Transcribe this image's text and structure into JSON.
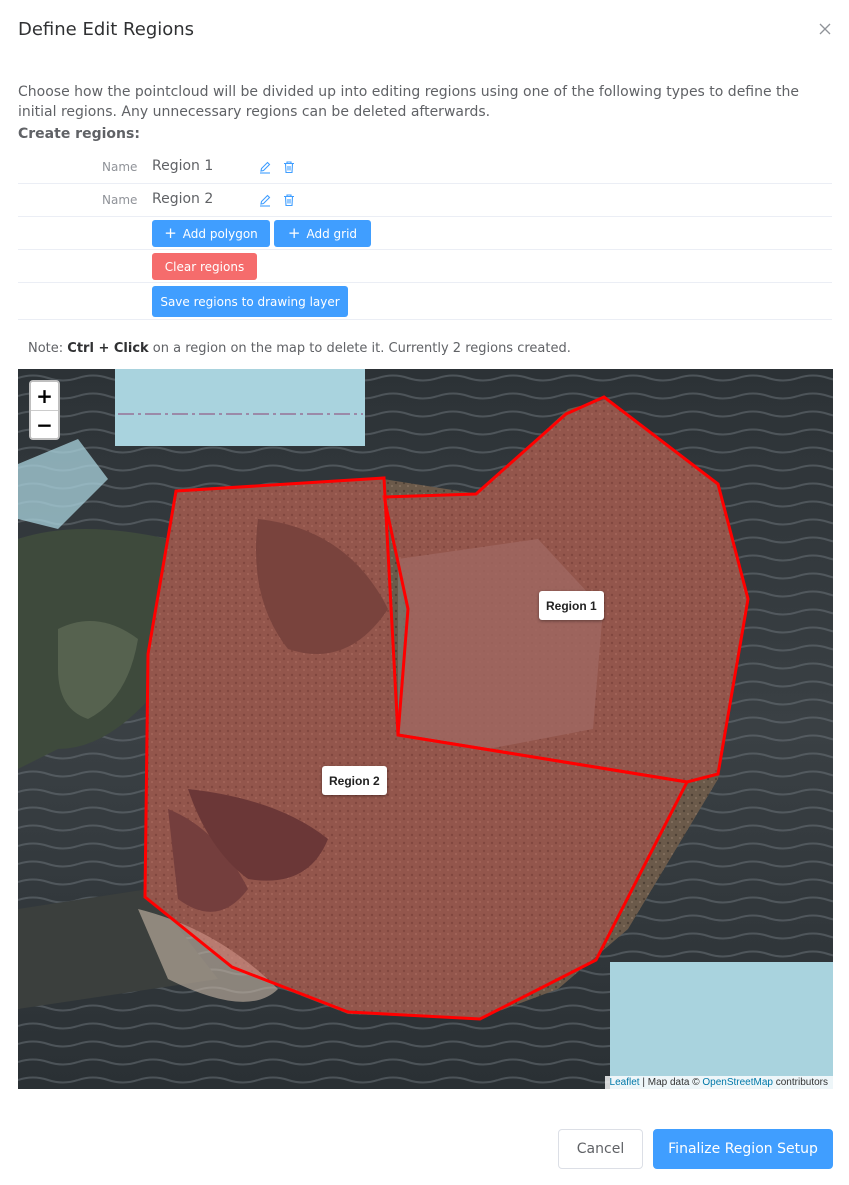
{
  "dialog": {
    "title": "Define Edit Regions",
    "description": "Choose how the pointcloud will be divided up into editing regions using one of the following types to define the initial regions. Any unnecessary regions can be deleted afterwards.",
    "create_label": "Create regions:"
  },
  "regions": [
    {
      "label": "Name",
      "value": "Region 1"
    },
    {
      "label": "Name",
      "value": "Region 2"
    }
  ],
  "actions": {
    "add_polygon": "Add polygon",
    "add_grid": "Add grid",
    "clear_regions": "Clear regions",
    "save_regions": "Save regions to drawing layer"
  },
  "note": {
    "prefix": "Note: ",
    "shortcut": "Ctrl + Click",
    "suffix": " on a region on the map to delete it. Currently 2 regions created."
  },
  "map": {
    "zoom_in": "+",
    "zoom_out": "−",
    "region_labels": [
      "Region 1",
      "Region 2"
    ],
    "attribution": {
      "leaflet": "Leaflet",
      "map_data": " | Map data © ",
      "osm": "OpenStreetMap",
      "contributors": " contributors"
    },
    "region_color": "#ff0000"
  },
  "footer": {
    "cancel": "Cancel",
    "finalize": "Finalize Region Setup"
  },
  "colors": {
    "primary": "#409eff",
    "danger": "#f56c6c"
  }
}
